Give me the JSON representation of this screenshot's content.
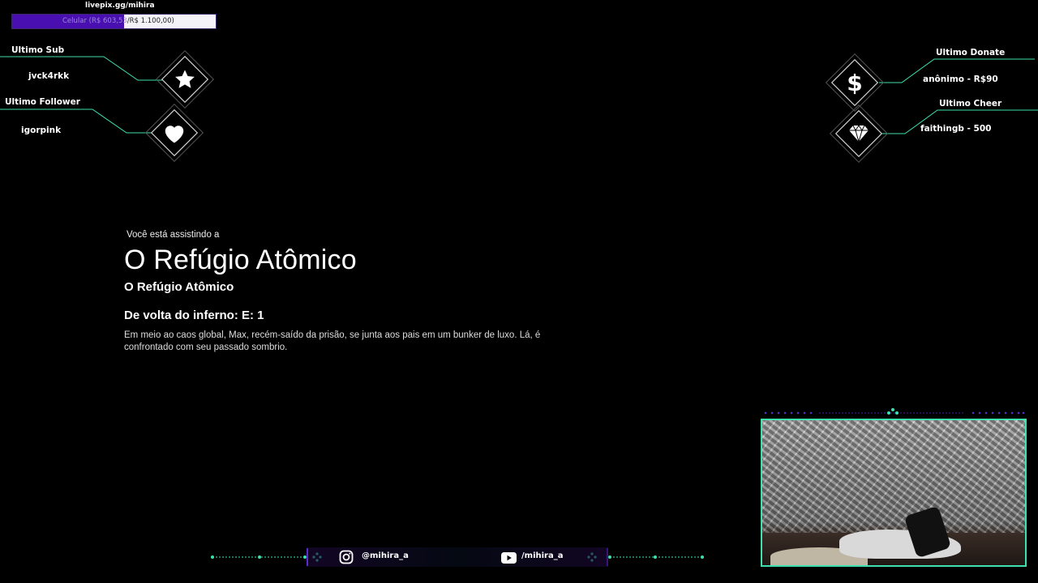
{
  "goal": {
    "url": "livepix.gg/mihira",
    "label_prefix": "Celular (R$ 603,53",
    "label_suffix": "/R$ 1.100,00)",
    "progress": 0.549,
    "fill_color": "#4a0fb0"
  },
  "alerts_left": {
    "sub_label": "Ultimo Sub",
    "sub_value": "jvck4rkk",
    "follower_label": "Ultimo Follower",
    "follower_value": "igorpink",
    "sub_icon": "star-icon",
    "follower_icon": "heart-icon"
  },
  "alerts_right": {
    "donate_label": "Ultimo Donate",
    "donate_value": "anônimo - R$90",
    "cheer_label": "Ultimo Cheer",
    "cheer_value": "faithingb - 500",
    "donate_icon": "dollar-icon",
    "cheer_icon": "diamond-gem-icon"
  },
  "watching": {
    "caption": "Você está assistindo a",
    "title": "O Refúgio Atômico",
    "subtitle": "O Refúgio Atômico",
    "episode": "De volta do inferno: E: 1",
    "description": "Em meio ao caos global, Max, recém-saído da prisão, se junta aos pais em um bunker de luxo. Lá, é confrontado com seu passado sombrio."
  },
  "socials": {
    "instagram": "@mihira_a",
    "youtube": "/mihira_a"
  },
  "colors": {
    "accent_line": "#3fe0b0",
    "accent_purple": "#4a0fb0"
  }
}
